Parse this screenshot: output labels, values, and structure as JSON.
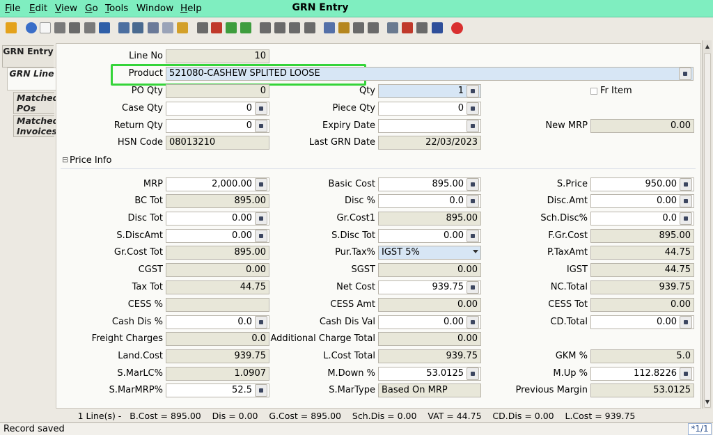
{
  "window": {
    "title": "GRN Entry"
  },
  "menu": [
    {
      "label": "File",
      "key": "F",
      "rest": "ile"
    },
    {
      "label": "Edit",
      "key": "E",
      "rest": "dit"
    },
    {
      "label": "View",
      "key": "V",
      "rest": "iew"
    },
    {
      "label": "Go",
      "key": "G",
      "rest": "o"
    },
    {
      "label": "Tools",
      "key": "T",
      "rest": "ools"
    },
    {
      "label": "Window",
      "key": "",
      "rest": "Window"
    },
    {
      "label": "Help",
      "key": "H",
      "rest": "elp"
    }
  ],
  "toolbar_icons": [
    "undo-icon",
    "help-icon",
    "new-icon",
    "copy-icon",
    "delete-icon",
    "cut-icon",
    "save-icon",
    "refresh-icon",
    "find-icon",
    "attach-icon",
    "chat-icon",
    "report-icon",
    "archive-icon",
    "home-icon",
    "back-icon",
    "forward-icon",
    "first-record-icon",
    "previous-record-icon",
    "next-record-icon",
    "last-record-icon",
    "print-preview-icon",
    "print-icon",
    "request-icon",
    "process-icon",
    "zoom-icon",
    "workflow-icon",
    "product-icon",
    "document-icon",
    "close-icon"
  ],
  "tabs": [
    "GRN Entry",
    "GRN Line",
    "Matched POs",
    "Matched Invoices"
  ],
  "form": {
    "line_no_label": "Line No",
    "line_no": "10",
    "product_label": "Product",
    "product": "521080-CASHEW SPLITED LOOSE",
    "po_qty_label": "PO Qty",
    "po_qty": "0",
    "qty_label": "Qty",
    "qty": "1",
    "fr_item_label": "Fr Item",
    "case_qty_label": "Case Qty",
    "case_qty": "0",
    "piece_qty_label": "Piece Qty",
    "piece_qty": "0",
    "return_qty_label": "Return Qty",
    "return_qty": "0",
    "expiry_date_label": "Expiry Date",
    "expiry_date": "",
    "new_mrp_label": "New MRP",
    "new_mrp": "0.00",
    "hsn_code_label": "HSN Code",
    "hsn_code": "08013210",
    "last_grn_date_label": "Last GRN Date",
    "last_grn_date": "22/03/2023"
  },
  "section": {
    "title": "Price Info",
    "toggle": "⊟"
  },
  "price": {
    "mrp_label": "MRP",
    "mrp": "2,000.00",
    "basic_cost_label": "Basic Cost",
    "basic_cost": "895.00",
    "s_price_label": "S.Price",
    "s_price": "950.00",
    "bc_tot_label": "BC Tot",
    "bc_tot": "895.00",
    "disc_pct_label": "Disc %",
    "disc_pct": "0.0",
    "disc_amt_label": "Disc.Amt",
    "disc_amt": "0.00",
    "disc_tot_label": "Disc Tot",
    "disc_tot": "0.00",
    "gr_cost1_label": "Gr.Cost1",
    "gr_cost1": "895.00",
    "sch_disc_label": "Sch.Disc%",
    "sch_disc": "0.0",
    "s_discamt_label": "S.DiscAmt",
    "s_discamt": "0.00",
    "s_disc_tot_label": "S.Disc Tot",
    "s_disc_tot": "0.00",
    "f_gr_cost_label": "F.Gr.Cost",
    "f_gr_cost": "895.00",
    "gr_cost_tot_label": "Gr.Cost Tot",
    "gr_cost_tot": "895.00",
    "pur_tax_label": "Pur.Tax%",
    "pur_tax": "IGST 5%",
    "p_taxamt_label": "P.TaxAmt",
    "p_taxamt": "44.75",
    "cgst_label": "CGST",
    "cgst": "0.00",
    "sgst_label": "SGST",
    "sgst": "0.00",
    "igst_label": "IGST",
    "igst": "44.75",
    "tax_tot_label": "Tax Tot",
    "tax_tot": "44.75",
    "net_cost_label": "Net Cost",
    "net_cost": "939.75",
    "nc_total_label": "NC.Total",
    "nc_total": "939.75",
    "cess_pct_label": "CESS %",
    "cess_pct": "",
    "cess_amt_label": "CESS Amt",
    "cess_amt": "0.00",
    "cess_tot_label": "CESS Tot",
    "cess_tot": "0.00",
    "cash_dis_pct_label": "Cash Dis %",
    "cash_dis_pct": "0.0",
    "cash_dis_val_label": "Cash Dis Val",
    "cash_dis_val": "0.00",
    "cd_total_label": "CD.Total",
    "cd_total": "0.00",
    "freight_label": "Freight Charges",
    "freight": "0.0",
    "add_charge_label": "Additional Charge Total",
    "add_charge": "0.00",
    "land_cost_label": "Land.Cost",
    "land_cost": "939.75",
    "l_cost_total_label": "L.Cost Total",
    "l_cost_total": "939.75",
    "gkm_label": "GKM %",
    "gkm": "5.0",
    "s_marlc_label": "S.MarLC%",
    "s_marlc": "1.0907",
    "m_down_label": "M.Down %",
    "m_down": "53.0125",
    "m_up_label": "M.Up %",
    "m_up": "112.8226",
    "s_marmrp_label": "S.MarMRP%",
    "s_marmrp": "52.5",
    "s_martype_label": "S.MarType",
    "s_martype": "Based On MRP",
    "prev_margin_label": "Previous Margin",
    "prev_margin": "53.0125"
  },
  "summary": "1 Line(s) -   B.Cost = 895.00    Dis = 0.00    G.Cost = 895.00    Sch.Dis = 0.00    VAT = 44.75    CD.Dis = 0.00    L.Cost = 939.75",
  "status": {
    "message": "Record saved",
    "page": "*1/1"
  },
  "colors": {
    "titlebar": "#7feec0",
    "highlight": "#35d43a",
    "readonly_field": "#e8e7d9",
    "selected_field": "#d7e6f5"
  }
}
